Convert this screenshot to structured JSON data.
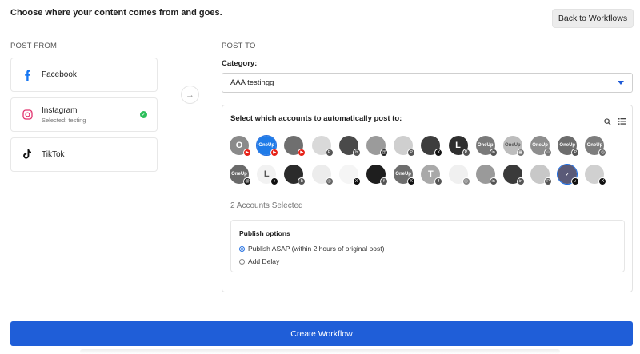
{
  "heading": "Choose where your content comes from and goes.",
  "back_button": "Back to Workflows",
  "post_from": {
    "label": "POST FROM",
    "sources": [
      {
        "name": "Facebook",
        "sub": "",
        "icon": "facebook-icon",
        "selected": false
      },
      {
        "name": "Instagram",
        "sub": "Selected: testing",
        "icon": "instagram-icon",
        "selected": true
      },
      {
        "name": "TikTok",
        "sub": "",
        "icon": "tiktok-icon",
        "selected": false
      }
    ]
  },
  "post_to": {
    "label": "POST TO",
    "category_label": "Category:",
    "category_value": "AAA testingg",
    "accounts_title": "Select which accounts to automatically post to:",
    "selected_count": "2 Accounts Selected",
    "publish": {
      "title": "Publish options",
      "option_asap": "Publish ASAP (within 2 hours of original post)",
      "option_delay": "Add Delay",
      "selected": "asap"
    }
  },
  "accounts_row1": [
    {
      "face": "O",
      "color": "#8a8a8a",
      "badge": "youtube",
      "badge_color": "#e62117",
      "badge_glyph": "▶",
      "selected": false
    },
    {
      "face": "OneUp",
      "color": "#1f7be8",
      "badge": "youtube",
      "badge_color": "#e62117",
      "badge_glyph": "▶",
      "selected": true
    },
    {
      "face": "",
      "color": "#6f6f6f",
      "badge": "youtube",
      "badge_color": "#e62117",
      "badge_glyph": "▶",
      "selected": false
    },
    {
      "face": "",
      "color": "#d9d9d9",
      "badge": "pinterest",
      "badge_color": "#555555",
      "badge_glyph": "P",
      "selected": false
    },
    {
      "face": "",
      "color": "#4a4a4a",
      "badge": "bluesky",
      "badge_color": "#555555",
      "badge_glyph": "b",
      "selected": false
    },
    {
      "face": "",
      "color": "#9b9b9b",
      "badge": "threads",
      "badge_color": "#222222",
      "badge_glyph": "@",
      "selected": false
    },
    {
      "face": "",
      "color": "#cfcfcf",
      "badge": "pinterest",
      "badge_color": "#555555",
      "badge_glyph": "P",
      "selected": false
    },
    {
      "face": "",
      "color": "#3d3d3d",
      "badge": "x",
      "badge_color": "#111111",
      "badge_glyph": "X",
      "selected": false
    },
    {
      "face": "L",
      "color": "#2f2f2f",
      "badge": "pinterest",
      "badge_color": "#555555",
      "badge_glyph": "P",
      "selected": false
    },
    {
      "face": "OneUp",
      "color": "#7a7a7a",
      "badge": "linkedin",
      "badge_color": "#555555",
      "badge_glyph": "in",
      "selected": false
    },
    {
      "face": "OneUp",
      "color": "#bdbdbd",
      "badge": "gmb",
      "badge_color": "#777777",
      "badge_glyph": "▦",
      "selected": false
    },
    {
      "face": "OneUp",
      "color": "#8e8e8e",
      "badge": "snapchat",
      "badge_color": "#777777",
      "badge_glyph": "☺",
      "selected": false
    },
    {
      "face": "OneUp",
      "color": "#6d6d6d",
      "badge": "pinterest",
      "badge_color": "#555555",
      "badge_glyph": "P",
      "selected": false
    },
    {
      "face": "OneUp",
      "color": "#7d7d7d",
      "badge": "instagram",
      "badge_color": "#666666",
      "badge_glyph": "◎",
      "selected": false
    }
  ],
  "accounts_row2": [
    {
      "face": "OneUp",
      "color": "#6a6a6a",
      "badge": "threads",
      "badge_color": "#222222",
      "badge_glyph": "@",
      "selected": false
    },
    {
      "face": "L",
      "color": "#f2f2f2",
      "badge": "tiktok",
      "badge_color": "#111111",
      "badge_glyph": "♪",
      "selected": false
    },
    {
      "face": "",
      "color": "#2b2b2b",
      "badge": "bluesky",
      "badge_color": "#555555",
      "badge_glyph": "b",
      "selected": false
    },
    {
      "face": "",
      "color": "#ececec",
      "badge": "instagram",
      "badge_color": "#666666",
      "badge_glyph": "◎",
      "selected": false
    },
    {
      "face": "",
      "color": "#f5f5f5",
      "badge": "x",
      "badge_color": "#111111",
      "badge_glyph": "X",
      "selected": false
    },
    {
      "face": "",
      "color": "#1e1e1e",
      "badge": "facebook",
      "badge_color": "#555555",
      "badge_glyph": "f",
      "selected": false
    },
    {
      "face": "OneUp",
      "color": "#6e6e6e",
      "badge": "x",
      "badge_color": "#111111",
      "badge_glyph": "X",
      "selected": false
    },
    {
      "face": "T",
      "color": "#a9a9a9",
      "badge": "facebook",
      "badge_color": "#555555",
      "badge_glyph": "f",
      "selected": false
    },
    {
      "face": "",
      "color": "#f0f0f0",
      "badge": "instagram",
      "badge_color": "#888888",
      "badge_glyph": "◎",
      "selected": false
    },
    {
      "face": "",
      "color": "#9a9a9a",
      "badge": "linkedin",
      "badge_color": "#555555",
      "badge_glyph": "in",
      "selected": false
    },
    {
      "face": "",
      "color": "#3a3a3a",
      "badge": "linkedin",
      "badge_color": "#555555",
      "badge_glyph": "in",
      "selected": false
    },
    {
      "face": "",
      "color": "#c8c8c8",
      "badge": "pinterest",
      "badge_color": "#555555",
      "badge_glyph": "P",
      "selected": false
    },
    {
      "face": "✓",
      "color": "#5a5a78",
      "badge": "tiktok",
      "badge_color": "#111111",
      "badge_glyph": "♪",
      "selected": true
    },
    {
      "face": "",
      "color": "#d0d0d0",
      "badge": "x",
      "badge_color": "#111111",
      "badge_glyph": "X",
      "selected": false
    }
  ],
  "create_button": "Create Workflow",
  "colors": {
    "primary": "#1f5ed8",
    "check": "#2dbf5b",
    "facebook": "#1877f2",
    "instagram": "#e1306c"
  }
}
